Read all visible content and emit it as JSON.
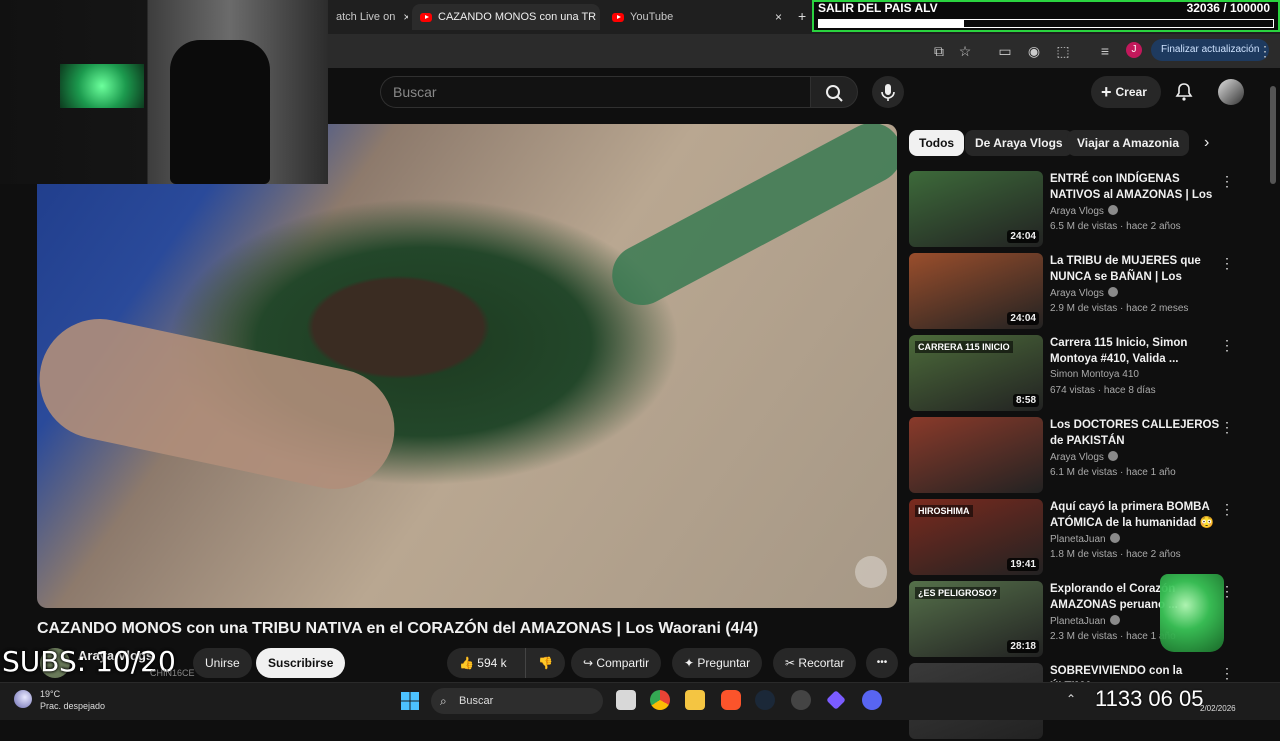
{
  "browser": {
    "tabs": [
      {
        "label": "atch Live on",
        "close": "×"
      },
      {
        "label": "CAZANDO MONOS con una TR",
        "close": "×"
      },
      {
        "label": "YouTube",
        "close": "×"
      }
    ],
    "new_tab": "+",
    "update_button": "Finalizar actualización",
    "profile_initial": "J"
  },
  "header": {
    "search_placeholder": "Buscar",
    "create_label": "Crear"
  },
  "video": {
    "title": "CAZANDO MONOS con una TRIBU NATIVA en el CORAZÓN del AMAZONAS | Los Waorani (4/4)",
    "channel": "Araya Vlogs",
    "join_label": "Unirse",
    "subscribe_label": "Suscribirse",
    "likes": "594 k",
    "share_label": "Compartir",
    "ask_label": "Preguntar",
    "clip_label": "Recortar",
    "more": "•••"
  },
  "sidebar": {
    "chips": [
      "Todos",
      "De Araya Vlogs",
      "Viajar a Amazonia"
    ],
    "recommendations": [
      {
        "title": "ENTRÉ con INDÍGENAS NATIVOS al AMAZONAS | Los ...",
        "channel": "Araya Vlogs",
        "verified": true,
        "meta": "6.5 M de vistas · hace 2 años",
        "duration": "24:04",
        "thumb_color": "#3d6a3a"
      },
      {
        "title": "La TRIBU de MUJERES que NUNCA se BAÑAN | Los Himba",
        "channel": "Araya Vlogs",
        "verified": true,
        "meta": "2.9 M de vistas · hace 2 meses",
        "duration": "24:04",
        "thumb_color": "#9a4e2c"
      },
      {
        "title": "Carrera 115 Inicio, Simon Montoya #410, Valida ...",
        "channel": "Simon Montoya 410",
        "verified": false,
        "meta": "674 vistas · hace 8 días",
        "duration": "8:58",
        "thumb_color": "#4c6b3a"
      },
      {
        "title": "Los DOCTORES CALLEJEROS de PAKISTÁN",
        "channel": "Araya Vlogs",
        "verified": true,
        "meta": "6.1 M de vistas · hace 1 año",
        "duration": "",
        "thumb_color": "#8a3a2a"
      },
      {
        "title": "Aquí cayó la primera BOMBA ATÓMICA de la humanidad 😳",
        "channel": "PlanetaJuan",
        "verified": true,
        "meta": "1.8 M de vistas · hace 2 años",
        "duration": "19:41",
        "thumb_color": "#7a2a1e"
      },
      {
        "title": "Explorando el Corazón AMAZONAS peruano ...",
        "channel": "PlanetaJuan",
        "verified": true,
        "meta": "2.3 M de vistas · hace 1 año",
        "duration": "28:18",
        "thumb_color": "#55704a"
      },
      {
        "title": "SOBREVIVIENDO con la ÚLTIMA",
        "channel": "",
        "verified": false,
        "meta": "",
        "duration": "",
        "thumb_color": "#3a3a3a"
      }
    ],
    "thumb_texts": [
      "CARRERA 115 INICIO",
      "HIROSHIMA",
      "¿ES PELIGROSO?"
    ]
  },
  "overlay": {
    "goal_title": "SALIR DEL PAIS ALV",
    "goal_count": "32036  / 100000",
    "goal_progress": 0.32,
    "subs_counter": "SUBS: 10/20",
    "cam_caption": "CHIN16CE"
  },
  "taskbar": {
    "weather_temp": "19°C",
    "weather_desc": "Prac. despejado",
    "search_label": "Buscar",
    "clock_big": "1133 06 05",
    "date_small": "2/02/2026"
  },
  "colors": {
    "accent_green": "#2ad33f",
    "yt_red": "#ff0000",
    "bg": "#0f0f0f"
  }
}
